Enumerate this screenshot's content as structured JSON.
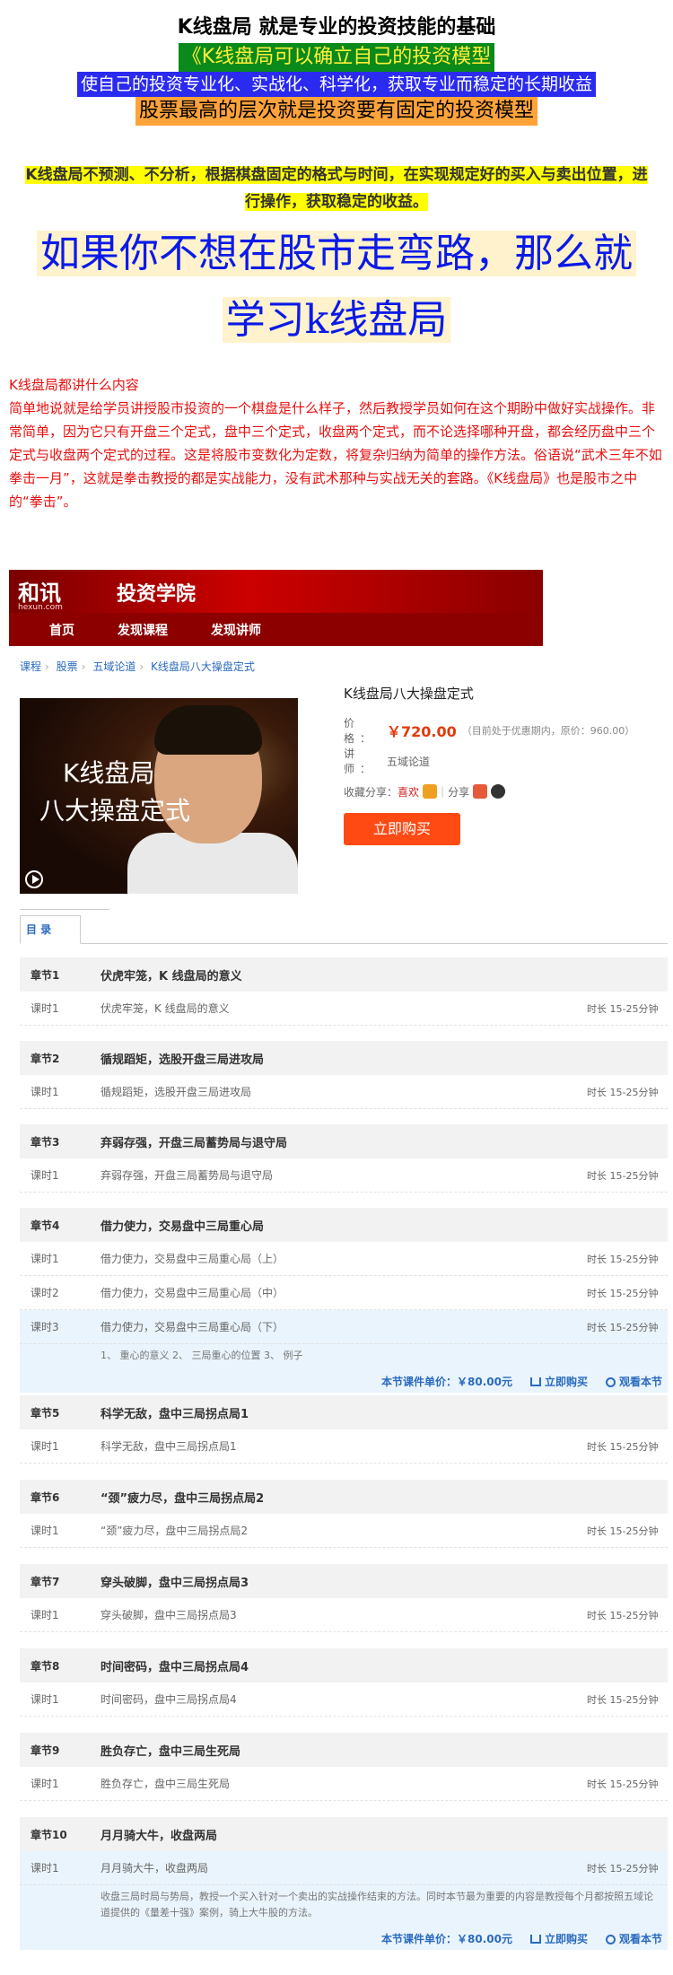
{
  "hero": {
    "title": "K线盘局 就是专业的投资技能的基础",
    "line2": "《K线盘局可以确立自己的投资模型",
    "line3": "使自己的投资专业化、实战化、科学化，获取专业而稳定的长期收益",
    "line4": "股票最高的层次就是投资要有固定的投资模型",
    "notice": "K线盘局不预测、不分析，根据棋盘固定的格式与时间，在实现规定好的买入与卖出位置，进行操作，获取稳定的收益。",
    "slogan1": "如果你不想在股市走弯路，那么就",
    "slogan2": "学习k线盘局"
  },
  "intro": {
    "heading": "K线盘局都讲什么内容",
    "body": "简单地说就是给学员讲授股市投资的一个棋盘是什么样子，然后教授学员如何在这个期盼中做好实战操作。非常简单，因为它只有开盘三个定式，盘中三个定式，收盘两个定式，而不论选择哪种开盘，都会经历盘中三个定式与收盘两个定式的过程。这是将股市变数化为定数，将复杂归纳为简单的操作方法。俗语说“武术三年不如拳击一月”，这就是拳击教授的都是实战能力，没有武术那种与实战无关的套路。《K线盘局》也是股市之中的“拳击”。"
  },
  "site": {
    "logo": "和讯",
    "logo_sub": "hexun.com",
    "title": "投资学院",
    "nav": [
      "首页",
      "发现课程",
      "发现讲师"
    ]
  },
  "breadcrumb": [
    "课程",
    "股票",
    "五域论道",
    "K线盘局八大操盘定式"
  ],
  "thumb": {
    "line1": "K线盘局",
    "line2": "八大操盘定式"
  },
  "course": {
    "name": "K线盘局八大操盘定式",
    "price_label": "价　　格：",
    "price": "￥720.00",
    "price_note": "（目前处于优惠期内，原价：960.00）",
    "teacher_label": "讲　　师：",
    "teacher": "五域论道",
    "share_label": "收藏分享：",
    "fav": "喜欢",
    "share": "分享",
    "buy": "立即购买"
  },
  "tab": "目 录",
  "duration": "时长 15-25分钟",
  "chapters": [
    {
      "k": "章节1",
      "t": "伏虎牢笼，K 线盘局的意义",
      "lessons": [
        {
          "k": "课时1",
          "t": "伏虎牢笼，K 线盘局的意义"
        }
      ]
    },
    {
      "k": "章节2",
      "t": "循规蹈矩，选股开盘三局进攻局",
      "lessons": [
        {
          "k": "课时1",
          "t": "循规蹈矩，选股开盘三局进攻局"
        }
      ]
    },
    {
      "k": "章节3",
      "t": "弃弱存强，开盘三局蓄势局与退守局",
      "lessons": [
        {
          "k": "课时1",
          "t": "弃弱存强，开盘三局蓄势局与退守局"
        }
      ]
    },
    {
      "k": "章节4",
      "t": "借力使力，交易盘中三局重心局",
      "lessons": [
        {
          "k": "课时1",
          "t": "借力使力，交易盘中三局重心局（上）"
        },
        {
          "k": "课时2",
          "t": "借力使力，交易盘中三局重心局（中）"
        },
        {
          "k": "课时3",
          "t": "借力使力，交易盘中三局重心局（下）"
        }
      ],
      "desc": "1、 重心的意义 2、 三局重心的位置 3、 例子",
      "unit_price": "本节课件单价：￥80.00元",
      "buy": "立即购买",
      "watch": "观看本节"
    },
    {
      "k": "章节5",
      "t": "科学无敌，盘中三局拐点局1",
      "lessons": [
        {
          "k": "课时1",
          "t": "科学无敌，盘中三局拐点局1"
        }
      ]
    },
    {
      "k": "章节6",
      "t": "“颈”疲力尽，盘中三局拐点局2",
      "lessons": [
        {
          "k": "课时1",
          "t": "“颈”疲力尽，盘中三局拐点局2"
        }
      ]
    },
    {
      "k": "章节7",
      "t": "穿头破脚，盘中三局拐点局3",
      "lessons": [
        {
          "k": "课时1",
          "t": "穿头破脚，盘中三局拐点局3"
        }
      ]
    },
    {
      "k": "章节8",
      "t": "时间密码，盘中三局拐点局4",
      "lessons": [
        {
          "k": "课时1",
          "t": "时间密码，盘中三局拐点局4"
        }
      ]
    },
    {
      "k": "章节9",
      "t": "胜负存亡，盘中三局生死局",
      "lessons": [
        {
          "k": "课时1",
          "t": "胜负存亡，盘中三局生死局"
        }
      ]
    },
    {
      "k": "章节10",
      "t": "月月骑大牛，收盘两局",
      "lessons": [
        {
          "k": "课时1",
          "t": "月月骑大牛，收盘两局"
        }
      ],
      "desc": "收盘三局时局与势局，教授一个买入针对一个卖出的实战操作结束的方法。同时本节最为重要的内容是教授每个月都按照五域论道提供的《量差十强》案例，骑上大牛股的方法。",
      "unit_price": "本节课件单价：￥80.00元",
      "buy": "立即购买",
      "watch": "观看本节"
    }
  ]
}
